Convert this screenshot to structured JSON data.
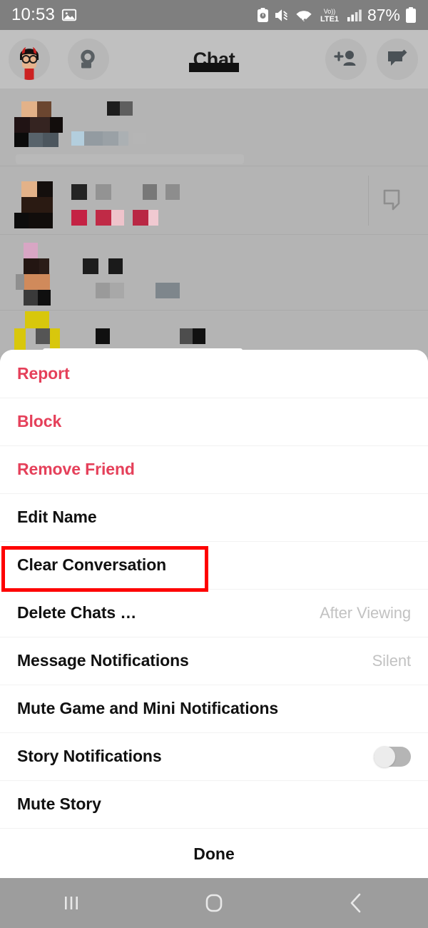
{
  "status_bar": {
    "time": "10:53",
    "battery_percent": "87%",
    "network": "LTE1",
    "volte": "Vo)",
    "icons": [
      "image-icon",
      "alarm-icon",
      "mute-icon",
      "wifi-icon",
      "volte-icon",
      "signal-icon",
      "battery-icon"
    ]
  },
  "header": {
    "title": "Chat",
    "avatar_label": "bitmoji-avatar",
    "search_label": "search-icon",
    "add_friend_label": "add-friend-icon",
    "new_chat_label": "new-chat-icon"
  },
  "chat_list": {
    "note": "blurred-censored-chat-rows",
    "rows": [
      {
        "name": "chat-row-1"
      },
      {
        "name": "chat-row-2"
      },
      {
        "name": "chat-row-3"
      },
      {
        "name": "chat-row-4"
      }
    ]
  },
  "sheet": {
    "items": [
      {
        "label": "Report",
        "style": "danger",
        "value": "",
        "control": "none",
        "name": "menu-item-report"
      },
      {
        "label": "Block",
        "style": "danger",
        "value": "",
        "control": "none",
        "name": "menu-item-block"
      },
      {
        "label": "Remove Friend",
        "style": "danger",
        "value": "",
        "control": "none",
        "name": "menu-item-remove-friend"
      },
      {
        "label": "Edit Name",
        "style": "normal",
        "value": "",
        "control": "none",
        "name": "menu-item-edit-name"
      },
      {
        "label": "Clear Conversation",
        "style": "normal",
        "value": "",
        "control": "none",
        "name": "menu-item-clear-conversation"
      },
      {
        "label": "Delete Chats …",
        "style": "normal",
        "value": "After Viewing",
        "control": "value",
        "name": "menu-item-delete-chats"
      },
      {
        "label": "Message Notifications",
        "style": "normal",
        "value": "Silent",
        "control": "value",
        "name": "menu-item-message-notifications"
      },
      {
        "label": "Mute Game and Mini Notifications",
        "style": "normal",
        "value": "",
        "control": "none",
        "name": "menu-item-mute-game-notifications"
      },
      {
        "label": "Story Notifications",
        "style": "normal",
        "value": "",
        "control": "toggle",
        "name": "menu-item-story-notifications",
        "toggle_on": false
      },
      {
        "label": "Mute Story",
        "style": "normal",
        "value": "",
        "control": "none",
        "name": "menu-item-mute-story"
      }
    ],
    "done_label": "Done"
  },
  "highlight": {
    "target": "Clear Conversation",
    "color": "#fe0000"
  },
  "nav_bar": {
    "recents_label": "recents-icon",
    "home_label": "home-icon",
    "back_label": "back-icon"
  },
  "colors": {
    "danger_red": "#e5405a",
    "highlight_red": "#fe0000",
    "status_bar_bg": "#7f7f7f",
    "header_bg": "#c0c0c0",
    "dim_bg": "#b4b4b4",
    "sheet_bg": "#ffffff",
    "nav_bg": "#9d9d9d",
    "value_gray": "#c2c2c2"
  }
}
